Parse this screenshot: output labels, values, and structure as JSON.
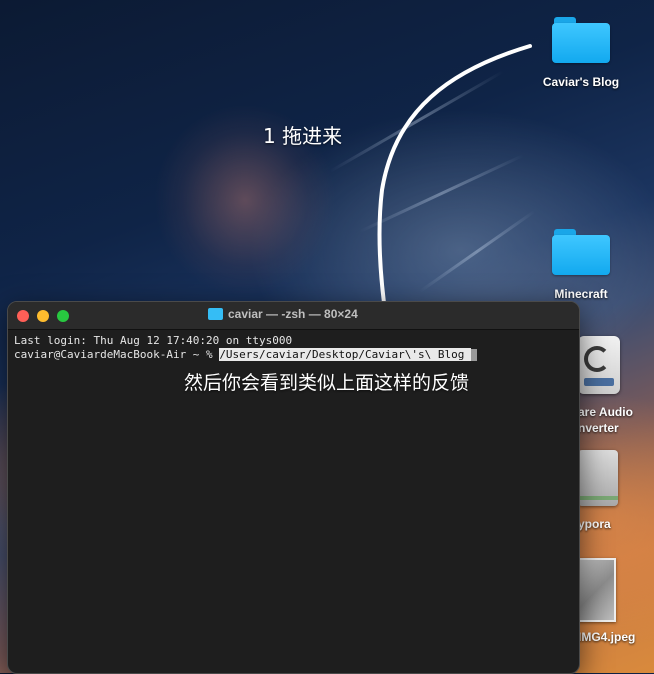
{
  "desktop": {
    "icons": [
      {
        "label": "Caviar's Blog"
      },
      {
        "label": "Minecraft"
      },
      {
        "label": "are Audio"
      },
      {
        "label": "nverter"
      },
      {
        "label": "ypora"
      },
      {
        "label": "IMG4.jpeg"
      }
    ]
  },
  "annotations": {
    "step1": "1 拖进来",
    "feedback": "然后你会看到类似上面这样的反馈"
  },
  "terminal": {
    "title": "caviar — -zsh — 80×24",
    "last_login": "Last login: Thu Aug 12 17:40:20 on ttys000",
    "prompt": "caviar@CaviardeMacBook-Air ~ % ",
    "command": "/Users/caviar/Desktop/Caviar\\'s\\ Blog "
  },
  "colors": {
    "folder": "#1aa6e8",
    "terminal_bg": "#1e1e1e",
    "close": "#ff5f57",
    "minimize": "#febc2e",
    "zoom": "#28c840"
  }
}
